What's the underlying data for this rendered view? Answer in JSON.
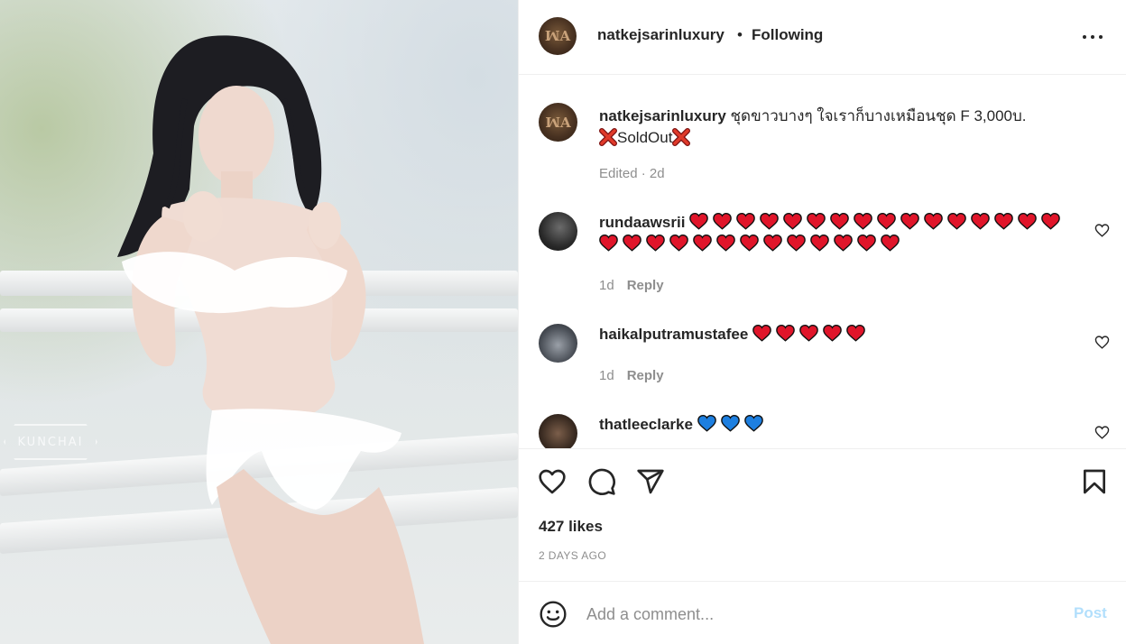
{
  "photo": {
    "watermark": "KUNCHAI"
  },
  "header": {
    "username": "natkejsarinluxury",
    "separator": "•",
    "follow_status": "Following"
  },
  "caption": {
    "username": "natkejsarinluxury",
    "text": "ชุดขาวบางๆ ใจเราก็บางเหมือนชุด F 3,000บ.",
    "status_text": "SoldOut",
    "meta": "Edited · 2d"
  },
  "comments": [
    {
      "username": "rundaawsrii",
      "hearts": 29,
      "heart_color": "red",
      "time": "1d",
      "reply_label": "Reply"
    },
    {
      "username": "haikalputramustafee",
      "hearts": 5,
      "heart_color": "red",
      "time": "1d",
      "reply_label": "Reply"
    },
    {
      "username": "thatleeclarke",
      "hearts": 3,
      "heart_color": "blue"
    }
  ],
  "footer": {
    "likes_text": "427 likes",
    "date_text": "2 DAYS AGO",
    "comment_placeholder": "Add a comment...",
    "post_label": "Post"
  },
  "colors": {
    "text": "#262626",
    "muted": "#8e8e8e",
    "divider": "#efefef",
    "post_disabled": "#b2dffc",
    "heart_red": "#e0152a",
    "heart_blue": "#1d7fe0"
  },
  "icons": [
    "heart-icon",
    "comment-icon",
    "share-icon",
    "bookmark-icon",
    "emoji-icon",
    "more-icon"
  ]
}
